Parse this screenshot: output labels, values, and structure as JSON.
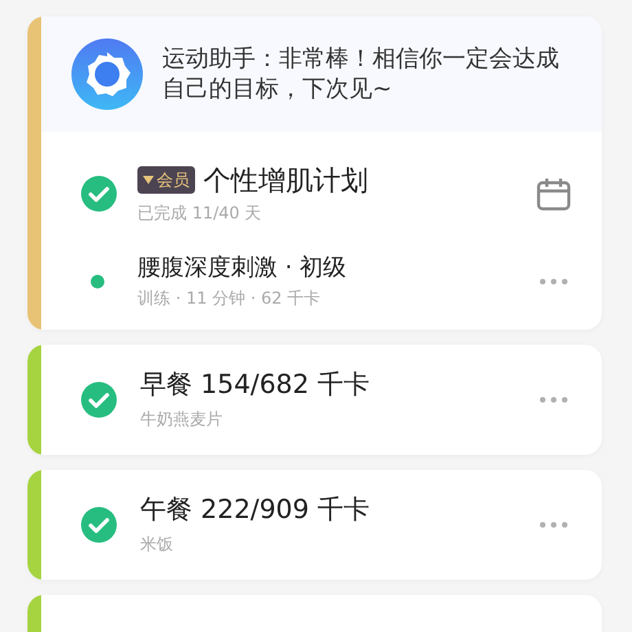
{
  "cards": [
    {
      "kind": "plan",
      "color": "#e8c275",
      "assistant": "运动助手：非常棒！相信你一定会达成自己的目标，下次见~",
      "plan": {
        "badge": "会员",
        "title": "个性增肌计划",
        "subtitle": "已完成 11/40 天",
        "checked": true
      },
      "tasks": [
        {
          "title": "腰腹深度刺激 · 初级",
          "subtitle": "训练 · 11 分钟 · 62 千卡"
        }
      ]
    },
    {
      "kind": "meal",
      "color": "#a6d340",
      "title": "早餐 154/682 千卡",
      "subtitle": "牛奶燕麦片",
      "checked": true
    },
    {
      "kind": "meal",
      "color": "#a6d340",
      "title": "午餐 222/909 千卡",
      "subtitle": "米饭",
      "checked": true
    },
    {
      "kind": "partial",
      "color": "#a6d340"
    }
  ]
}
